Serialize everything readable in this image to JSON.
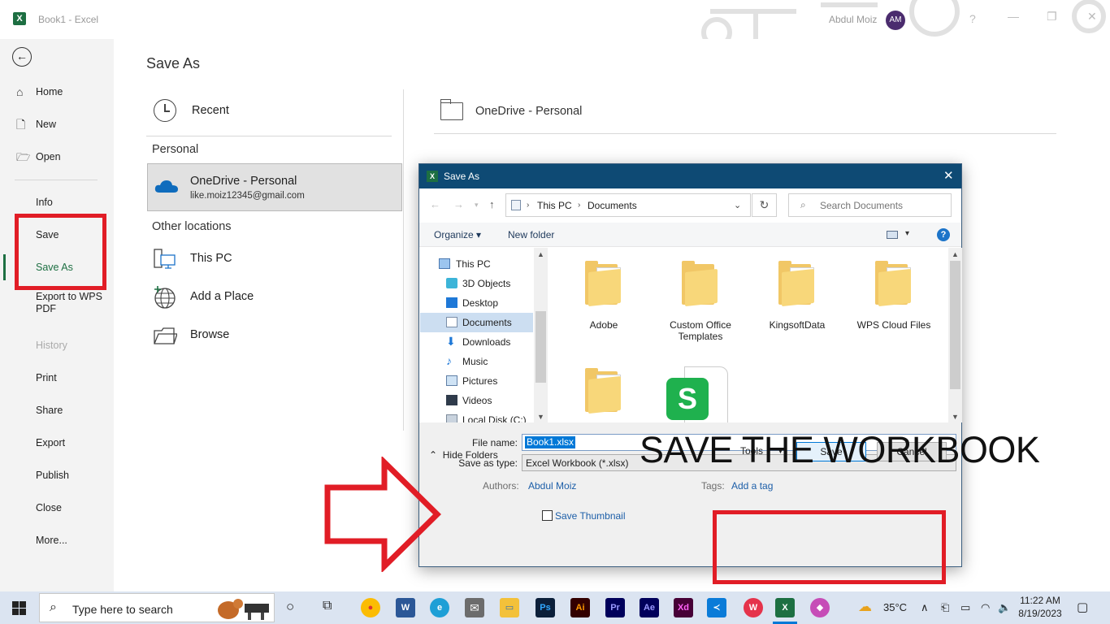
{
  "window": {
    "title": "Book1  -  Excel",
    "user_name": "Abdul Moiz",
    "user_initials": "AM",
    "help": "?"
  },
  "nav": {
    "back": "←",
    "items": [
      {
        "label": "Home"
      },
      {
        "label": "New"
      },
      {
        "label": "Open"
      },
      {
        "label": "Info"
      },
      {
        "label": "Save"
      },
      {
        "label": "Save As"
      },
      {
        "label": "Export to WPS PDF"
      },
      {
        "label": "History"
      },
      {
        "label": "Print"
      },
      {
        "label": "Share"
      },
      {
        "label": "Export"
      },
      {
        "label": "Publish"
      },
      {
        "label": "Close"
      },
      {
        "label": "More..."
      }
    ]
  },
  "save_as": {
    "title": "Save As",
    "recent": "Recent",
    "personal_header": "Personal",
    "onedrive_name": "OneDrive - Personal",
    "onedrive_email": "like.moiz12345@gmail.com",
    "other_header": "Other locations",
    "this_pc": "This PC",
    "add_place": "Add a Place",
    "browse": "Browse",
    "right_location": "OneDrive - Personal"
  },
  "dialog": {
    "title": "Save As",
    "breadcrumb": [
      "This PC",
      "Documents"
    ],
    "search_placeholder": "Search Documents",
    "organize": "Organize ▾",
    "new_folder": "New folder",
    "tree": [
      "This PC",
      "3D Objects",
      "Desktop",
      "Documents",
      "Downloads",
      "Music",
      "Pictures",
      "Videos",
      "Local Disk (C:)"
    ],
    "files": [
      "Adobe",
      "Custom Office Templates",
      "KingsoftData",
      "WPS Cloud Files"
    ],
    "file_name_label": "File name:",
    "file_name": "Book1.xlsx",
    "save_type_label": "Save as type:",
    "save_type": "Excel Workbook (*.xlsx)",
    "authors_label": "Authors:",
    "authors": "Abdul Moiz",
    "tags_label": "Tags:",
    "tags": "Add a tag",
    "thumbnail": "Save Thumbnail",
    "hide_folders": "Hide Folders",
    "tools": "Tools",
    "save": "Save",
    "cancel": "Cancel"
  },
  "overlay": {
    "caption": "SAVE THE WORKBOOK",
    "highlight_color": "#e11d26"
  },
  "taskbar": {
    "search_placeholder": "Type here to search",
    "apps": [
      "Chrome",
      "Word",
      "Edge",
      "Mail",
      "File Explorer",
      "Photoshop",
      "Illustrator",
      "Premiere Pro",
      "After Effects",
      "Adobe XD",
      "VS Code",
      "WPS Office",
      "Excel",
      "Paint"
    ],
    "weather": "35°C",
    "time": "11:22 AM",
    "date": "8/19/2023"
  },
  "colors": {
    "excel_green": "#1d6f42",
    "dialog_title": "#0e4a74",
    "link_blue": "#1c5ea8",
    "taskbar": "#dbe4f1"
  }
}
